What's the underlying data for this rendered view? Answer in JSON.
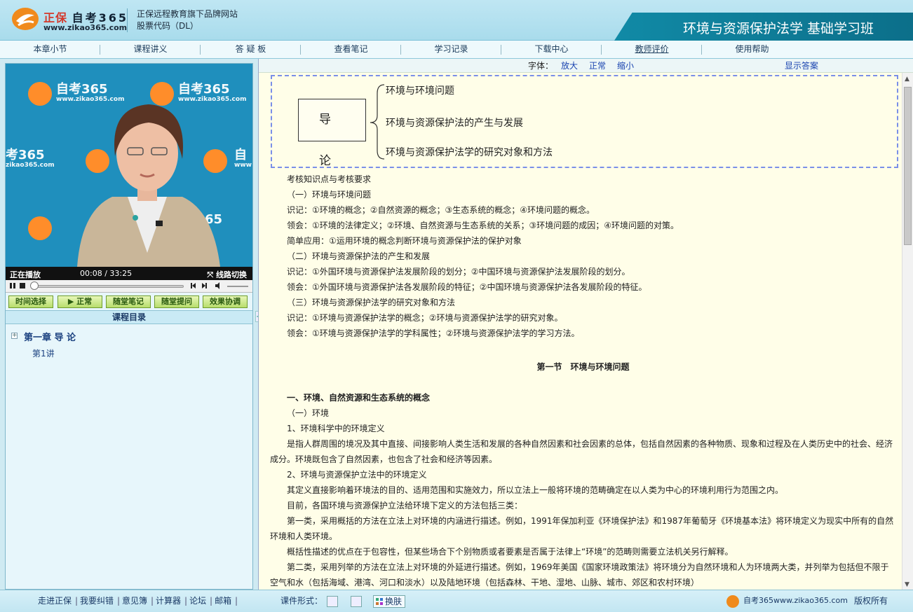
{
  "header": {
    "brand_main": "正保",
    "brand_sub": "自考365",
    "url": "www.zikao365.com",
    "tagline_1": "正保远程教育旗下品牌网站",
    "tagline_2": "股票代码（DL）",
    "course_title": "环境与资源保护法学 基础学习班"
  },
  "nav": [
    {
      "label": "本章小节"
    },
    {
      "label": "课程讲义"
    },
    {
      "label": "答 疑 板"
    },
    {
      "label": "查看笔记"
    },
    {
      "label": "学习记录"
    },
    {
      "label": "下载中心"
    },
    {
      "label": "教师评价"
    },
    {
      "label": "使用帮助"
    }
  ],
  "video": {
    "watermark_brand": "自考365",
    "watermark_url": "www.zikao365.com",
    "watermark_partial_1": "考365",
    "watermark_partial_2": "zikao365.com",
    "watermark_partial_3": "自",
    "watermark_partial_4": "www",
    "status": "正在播放",
    "current_time": "00:08",
    "separator": "/",
    "total_time": "33:25",
    "line_switch": "线路切换",
    "progress": 0.004
  },
  "actions": [
    "时间选择",
    "正常",
    "随堂笔记",
    "随堂提问",
    "效果协调"
  ],
  "catalog": {
    "title": "课程目录",
    "chapter": "第一章  导 论",
    "lecture": "第1讲"
  },
  "toolbar": {
    "font_label": "字体：",
    "enlarge": "放大",
    "normal": "正常",
    "shrink": "缩小",
    "show_answer": "显示答案"
  },
  "diagram": {
    "root": "导 论",
    "branches": [
      "环境与环境问题",
      "环境与资源保护法的产生与发展",
      "环境与资源保护法学的研究对象和方法"
    ]
  },
  "content": {
    "l01": "考核知识点与考核要求",
    "l02": "（一）环境与环境问题",
    "l03": "识记：①环境的概念；②自然资源的概念；③生态系统的概念；④环境问题的概念。",
    "l04": "领会：①环境的法律定义；②环境、自然资源与生态系统的关系；③环境问题的成因；④环境问题的对策。",
    "l05": "简单应用：①运用环境的概念判断环境与资源保护法的保护对象",
    "l06": "（二）环境与资源保护法的产生和发展",
    "l07": "识记：①外国环境与资源保护法发展阶段的划分；②中国环境与资源保护法发展阶段的划分。",
    "l08": "领会：①外国环境与资源保护法各发展阶段的特征；②中国环境与资源保护法各发展阶段的特征。",
    "l09": "（三）环境与资源保护法学的研究对象和方法",
    "l10": "识记：①环境与资源保护法学的概念；②环境与资源保护法学的研究对象。",
    "l11": "领会：①环境与资源保护法学的学科属性；②环境与资源保护法学的学习方法。",
    "section": "第一节　环境与环境问题",
    "h1": "一、环境、自然资源和生态系统的概念",
    "l12": "（一）环境",
    "l13": "1、环境科学中的环境定义",
    "l14": "是指人群周围的境况及其中直接、间接影响人类生活和发展的各种自然因素和社会因素的总体，包括自然因素的各种物质、现象和过程及在人类历史中的社会、经济成分。环境既包含了自然因素，也包含了社会和经济等因素。",
    "l15": "2、环境与资源保护立法中的环境定义",
    "l16": "其定义直接影响着环境法的目的、适用范围和实施效力，所以立法上一般将环境的范畴确定在以人类为中心的环境利用行为范围之内。",
    "l17": "目前，各国环境与资源保护立法给环境下定义的方法包括三类：",
    "l18": "第一类，采用概括的方法在立法上对环境的内涵进行描述。例如，1991年保加利亚《环境保护法》和1987年葡萄牙《环境基本法》将环境定义为现实中所有的自然环境和人类环境。",
    "l19": "概括性描述的优点在于包容性，但某些场合下个别物质或者要素是否属于法律上“环境”的范畴则需要立法机关另行解释。",
    "l20": "第二类，采用列举的方法在立法上对环境的外延进行描述。例如，1969年美国《国家环境政策法》将环境分为自然环境和人为环境两大类，并列举为包括但不限于空气和水（包括海域、港湾、河口和淡水）以及陆地环境（包括森林、干地、湿地、山脉、城市、郊区和农村环境）"
  },
  "footer": {
    "links": [
      "走进正保",
      "我要纠错",
      "意见簿",
      "计算器",
      "论坛",
      "邮箱"
    ],
    "format_label": "课件形式：",
    "skin": "换肤",
    "site": "自考365www.zikao365.com",
    "copyright": "版权所有"
  },
  "colors": {
    "header_bg": "#a9dcec",
    "banner": "#118aa6",
    "content_bg": "#fffee8",
    "link": "#1a44b0",
    "action_btn": "#b8dd6c"
  }
}
